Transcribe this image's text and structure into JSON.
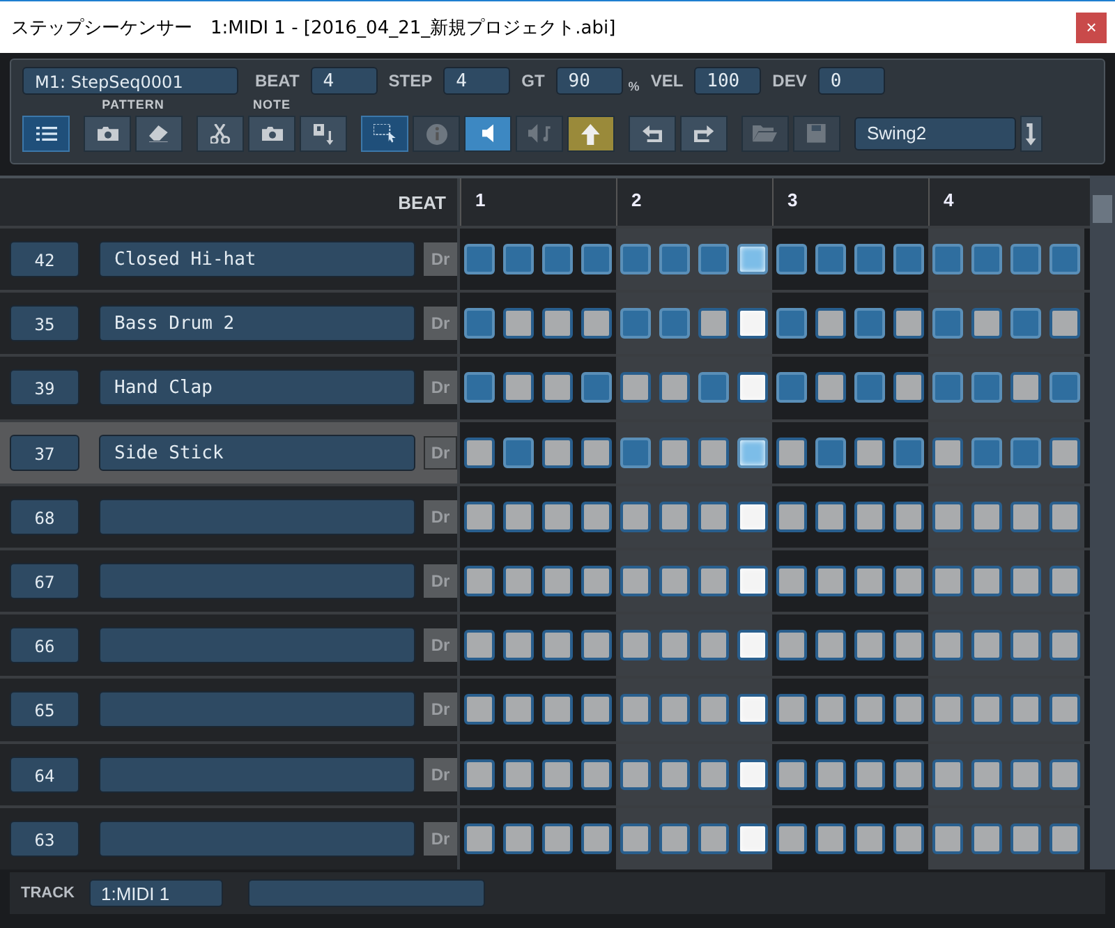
{
  "window": {
    "title": "ステップシーケンサー　1:MIDI 1 - [2016_04_21_新規プロジェクト.abi]",
    "close": "×"
  },
  "header_fields": [
    {
      "value": "M1: StepSeq0001",
      "kind": "name"
    },
    {
      "label": "BEAT",
      "value": "4",
      "kind": "num"
    },
    {
      "label": "STEP",
      "value": "4",
      "kind": "num"
    },
    {
      "label": "GT",
      "value": "90",
      "unit": "%",
      "kind": "num"
    },
    {
      "label": "VEL",
      "value": "100",
      "kind": "num"
    },
    {
      "label": "DEV",
      "value": "0",
      "kind": "num"
    }
  ],
  "toolbar": [
    {
      "buttons": [
        {
          "on": true,
          "disabled": false
        }
      ]
    },
    {
      "label": "PATTERN",
      "buttons": [
        {
          "on": false,
          "disabled": false
        },
        {
          "on": false,
          "disabled": false
        }
      ]
    },
    {
      "label": "NOTE",
      "buttons": [
        {
          "on": false,
          "disabled": false
        },
        {
          "on": false,
          "disabled": false
        },
        {
          "on": false,
          "disabled": false
        }
      ]
    },
    {
      "buttons": [
        {
          "on": true,
          "disabled": false
        },
        {
          "on": false,
          "disabled": true
        },
        {
          "on": true,
          "disabled": false
        },
        {
          "on": false,
          "disabled": true
        },
        {
          "on": true,
          "disabled": false
        }
      ]
    },
    {
      "buttons": [
        {
          "on": false,
          "disabled": false
        },
        {
          "on": false,
          "disabled": false
        }
      ]
    },
    {
      "buttons": [
        {
          "on": false,
          "disabled": true
        },
        {
          "on": false,
          "disabled": true
        }
      ]
    }
  ],
  "swing": {
    "value": "Swing2"
  },
  "grid": {
    "beat_label": "BEAT",
    "beats": [
      "1",
      "2",
      "3",
      "4"
    ],
    "step_columns": [
      {
        "current": false
      },
      {
        "current": false
      },
      {
        "current": false
      },
      {
        "current": false
      },
      {
        "current": false
      },
      {
        "current": false
      },
      {
        "current": false
      },
      {
        "current": true
      },
      {
        "current": false
      },
      {
        "current": false
      },
      {
        "current": false
      },
      {
        "current": false
      },
      {
        "current": false
      },
      {
        "current": false
      },
      {
        "current": false
      },
      {
        "current": false
      }
    ],
    "rows": [
      {
        "note": "42",
        "name": "Closed Hi-hat",
        "drum": "Dr",
        "selected": false,
        "steps": [
          true,
          true,
          true,
          true,
          true,
          true,
          true,
          true,
          true,
          true,
          true,
          true,
          true,
          true,
          true,
          true
        ]
      },
      {
        "note": "35",
        "name": "Bass Drum 2",
        "drum": "Dr",
        "selected": false,
        "steps": [
          true,
          false,
          false,
          false,
          true,
          true,
          false,
          false,
          true,
          false,
          true,
          false,
          true,
          false,
          true,
          false
        ]
      },
      {
        "note": "39",
        "name": "Hand Clap",
        "drum": "Dr",
        "selected": false,
        "steps": [
          true,
          false,
          false,
          true,
          false,
          false,
          true,
          false,
          true,
          false,
          true,
          false,
          true,
          true,
          false,
          true
        ]
      },
      {
        "note": "37",
        "name": "Side Stick",
        "drum": "Dr",
        "selected": true,
        "steps": [
          false,
          true,
          false,
          false,
          true,
          false,
          false,
          true,
          false,
          true,
          false,
          true,
          false,
          true,
          true,
          false
        ]
      },
      {
        "note": "68",
        "drum": "Dr",
        "selected": false,
        "steps": [
          false,
          false,
          false,
          false,
          false,
          false,
          false,
          false,
          false,
          false,
          false,
          false,
          false,
          false,
          false,
          false
        ]
      },
      {
        "note": "67",
        "drum": "Dr",
        "selected": false,
        "steps": [
          false,
          false,
          false,
          false,
          false,
          false,
          false,
          false,
          false,
          false,
          false,
          false,
          false,
          false,
          false,
          false
        ]
      },
      {
        "note": "66",
        "drum": "Dr",
        "selected": false,
        "steps": [
          false,
          false,
          false,
          false,
          false,
          false,
          false,
          false,
          false,
          false,
          false,
          false,
          false,
          false,
          false,
          false
        ]
      },
      {
        "note": "65",
        "drum": "Dr",
        "selected": false,
        "steps": [
          false,
          false,
          false,
          false,
          false,
          false,
          false,
          false,
          false,
          false,
          false,
          false,
          false,
          false,
          false,
          false
        ]
      },
      {
        "note": "64",
        "drum": "Dr",
        "selected": false,
        "steps": [
          false,
          false,
          false,
          false,
          false,
          false,
          false,
          false,
          false,
          false,
          false,
          false,
          false,
          false,
          false,
          false
        ]
      },
      {
        "note": "63",
        "drum": "Dr",
        "selected": false,
        "steps": [
          false,
          false,
          false,
          false,
          false,
          false,
          false,
          false,
          false,
          false,
          false,
          false,
          false,
          false,
          false,
          false
        ]
      }
    ]
  },
  "footer": {
    "label": "TRACK",
    "track": "1:MIDI 1"
  }
}
